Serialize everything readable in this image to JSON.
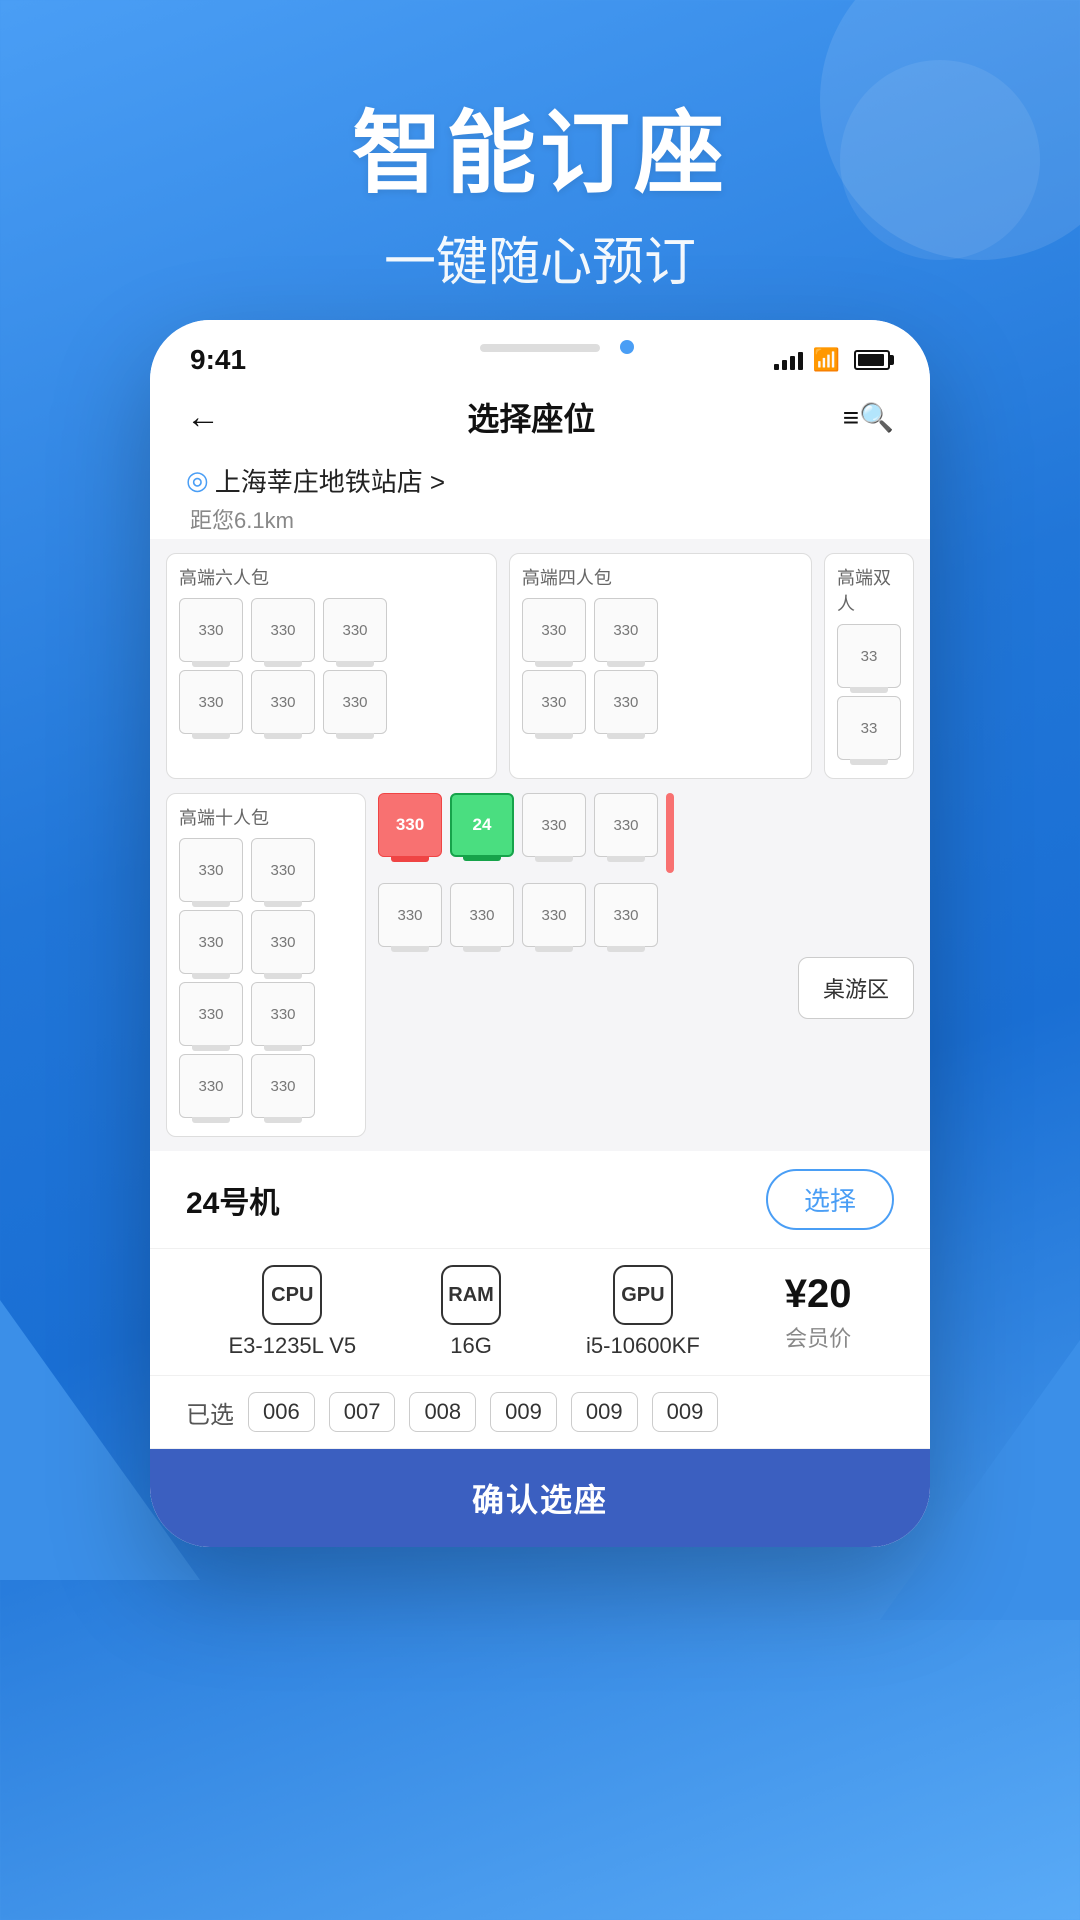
{
  "hero": {
    "title": "智能订座",
    "subtitle": "一键随心预订"
  },
  "status_bar": {
    "time": "9:41",
    "signal": "●●●●",
    "wifi": "WiFi",
    "battery": "full"
  },
  "header": {
    "title": "选择座位",
    "back_label": "←",
    "filter_label": "≡🔍"
  },
  "location": {
    "name": "上海莘庄地铁站店 >",
    "distance": "距您6.1km"
  },
  "sections": {
    "top_left": "高端六人包",
    "top_middle": "高端四人包",
    "top_right": "高端双人",
    "bottom_left": "高端十人包"
  },
  "seat_prices": {
    "normal": "330",
    "occupied_price": "330",
    "selected_number": "24"
  },
  "machine": {
    "name": "24号机",
    "select_label": "选择",
    "cpu_label": "CPU",
    "cpu_value": "E3-1235L V5",
    "ram_label": "RAM",
    "ram_value": "16G",
    "gpu_label": "GPU",
    "gpu_value": "i5-10600KF",
    "price": "¥20",
    "price_label": "会员价"
  },
  "selected_seats": {
    "label": "已选",
    "seats": [
      "006",
      "007",
      "008",
      "009",
      "009",
      "009"
    ]
  },
  "confirm": {
    "label": "确认选座"
  },
  "board_game": {
    "label": "桌游区"
  }
}
